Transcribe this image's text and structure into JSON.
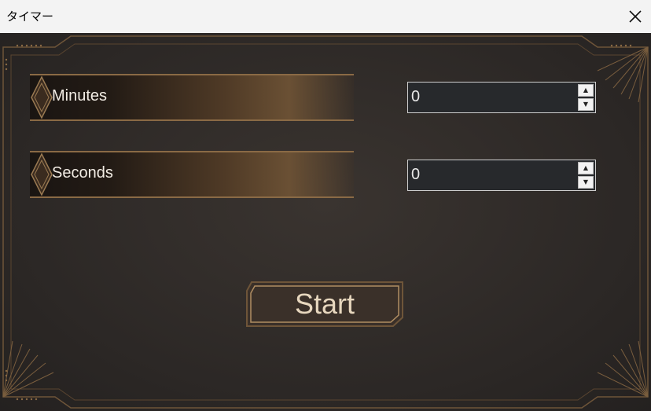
{
  "window": {
    "title": "タイマー"
  },
  "fields": [
    {
      "label": "Minutes",
      "value": "0"
    },
    {
      "label": "Seconds",
      "value": "0"
    }
  ],
  "start_label": "Start",
  "colors": {
    "gold": "#8a6a45",
    "panel_bg": "#2e2a28",
    "titlebar_bg": "#f3f3f3"
  },
  "icons": [
    "close-icon",
    "spin-up-icon",
    "spin-down-icon",
    "diamond-ornament-icon"
  ]
}
